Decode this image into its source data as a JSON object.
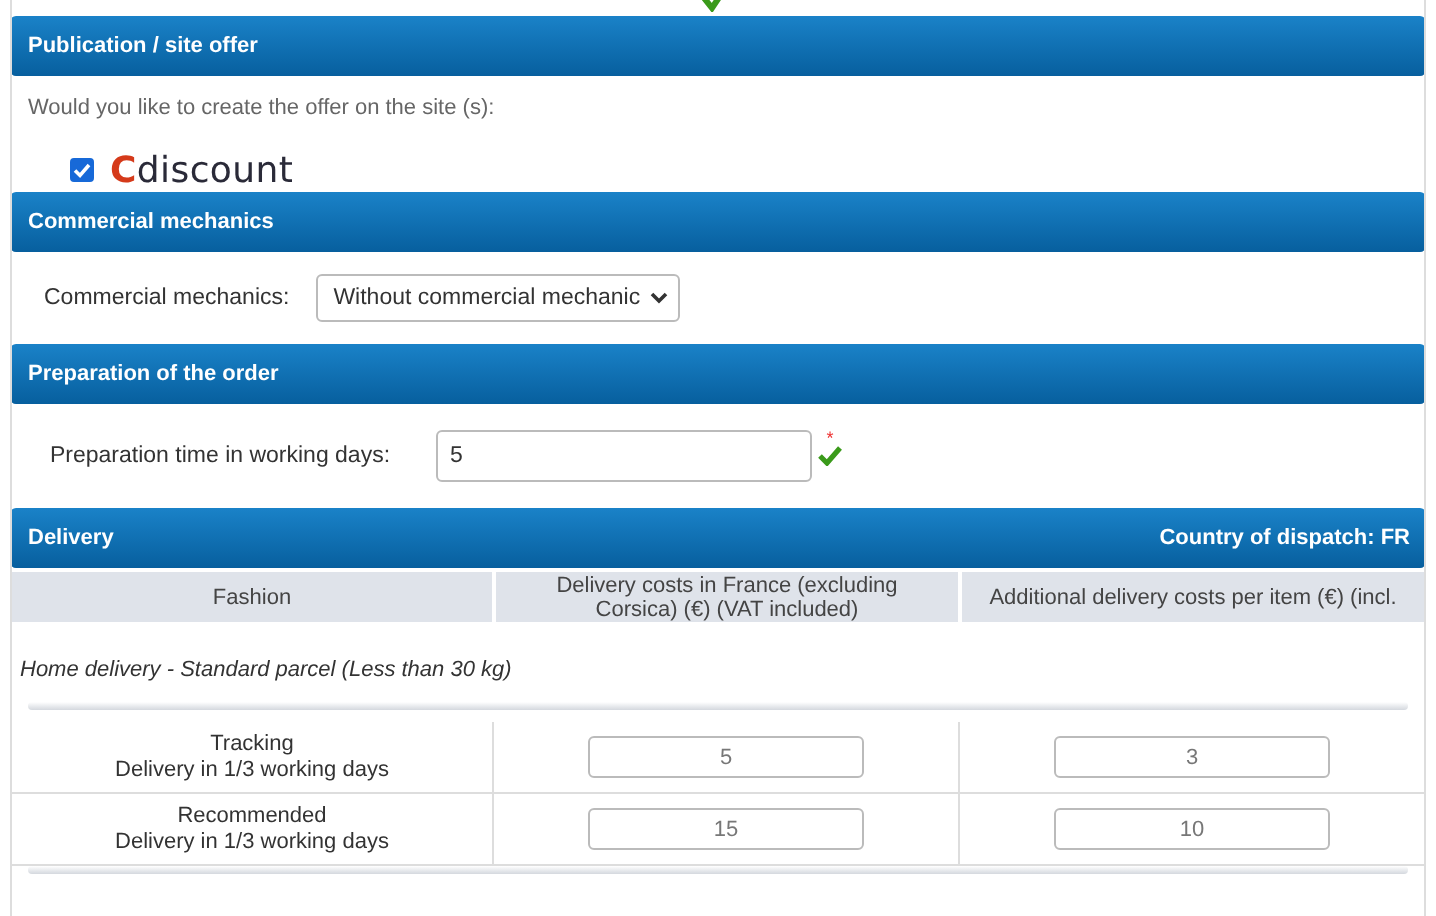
{
  "publication": {
    "title": "Publication / site offer",
    "question": "Would you like to create the offer on the site (s):",
    "site": {
      "name": "Cdiscount",
      "checked": true
    }
  },
  "commercial": {
    "title": "Commercial mechanics",
    "label": "Commercial mechanics:",
    "value": "Without commercial mechanic"
  },
  "preparation": {
    "title": "Preparation of the order",
    "label": "Preparation time in working days:",
    "value": "5",
    "required_mark": "*",
    "valid": true
  },
  "delivery": {
    "title": "Delivery",
    "country": "Country of dispatch: FR",
    "columns": [
      "Fashion",
      "Delivery costs in France (excluding Corsica) (€) (VAT included)",
      "Additional delivery costs per item (€) (incl."
    ],
    "group": "Home delivery - Standard parcel (Less than 30 kg)",
    "rows": [
      {
        "name": "Tracking",
        "detail": "Delivery in 1/3 working days",
        "cost": "5",
        "additional": "3"
      },
      {
        "name": "Recommended",
        "detail": "Delivery in 1/3 working days",
        "cost": "15",
        "additional": "10"
      }
    ]
  }
}
